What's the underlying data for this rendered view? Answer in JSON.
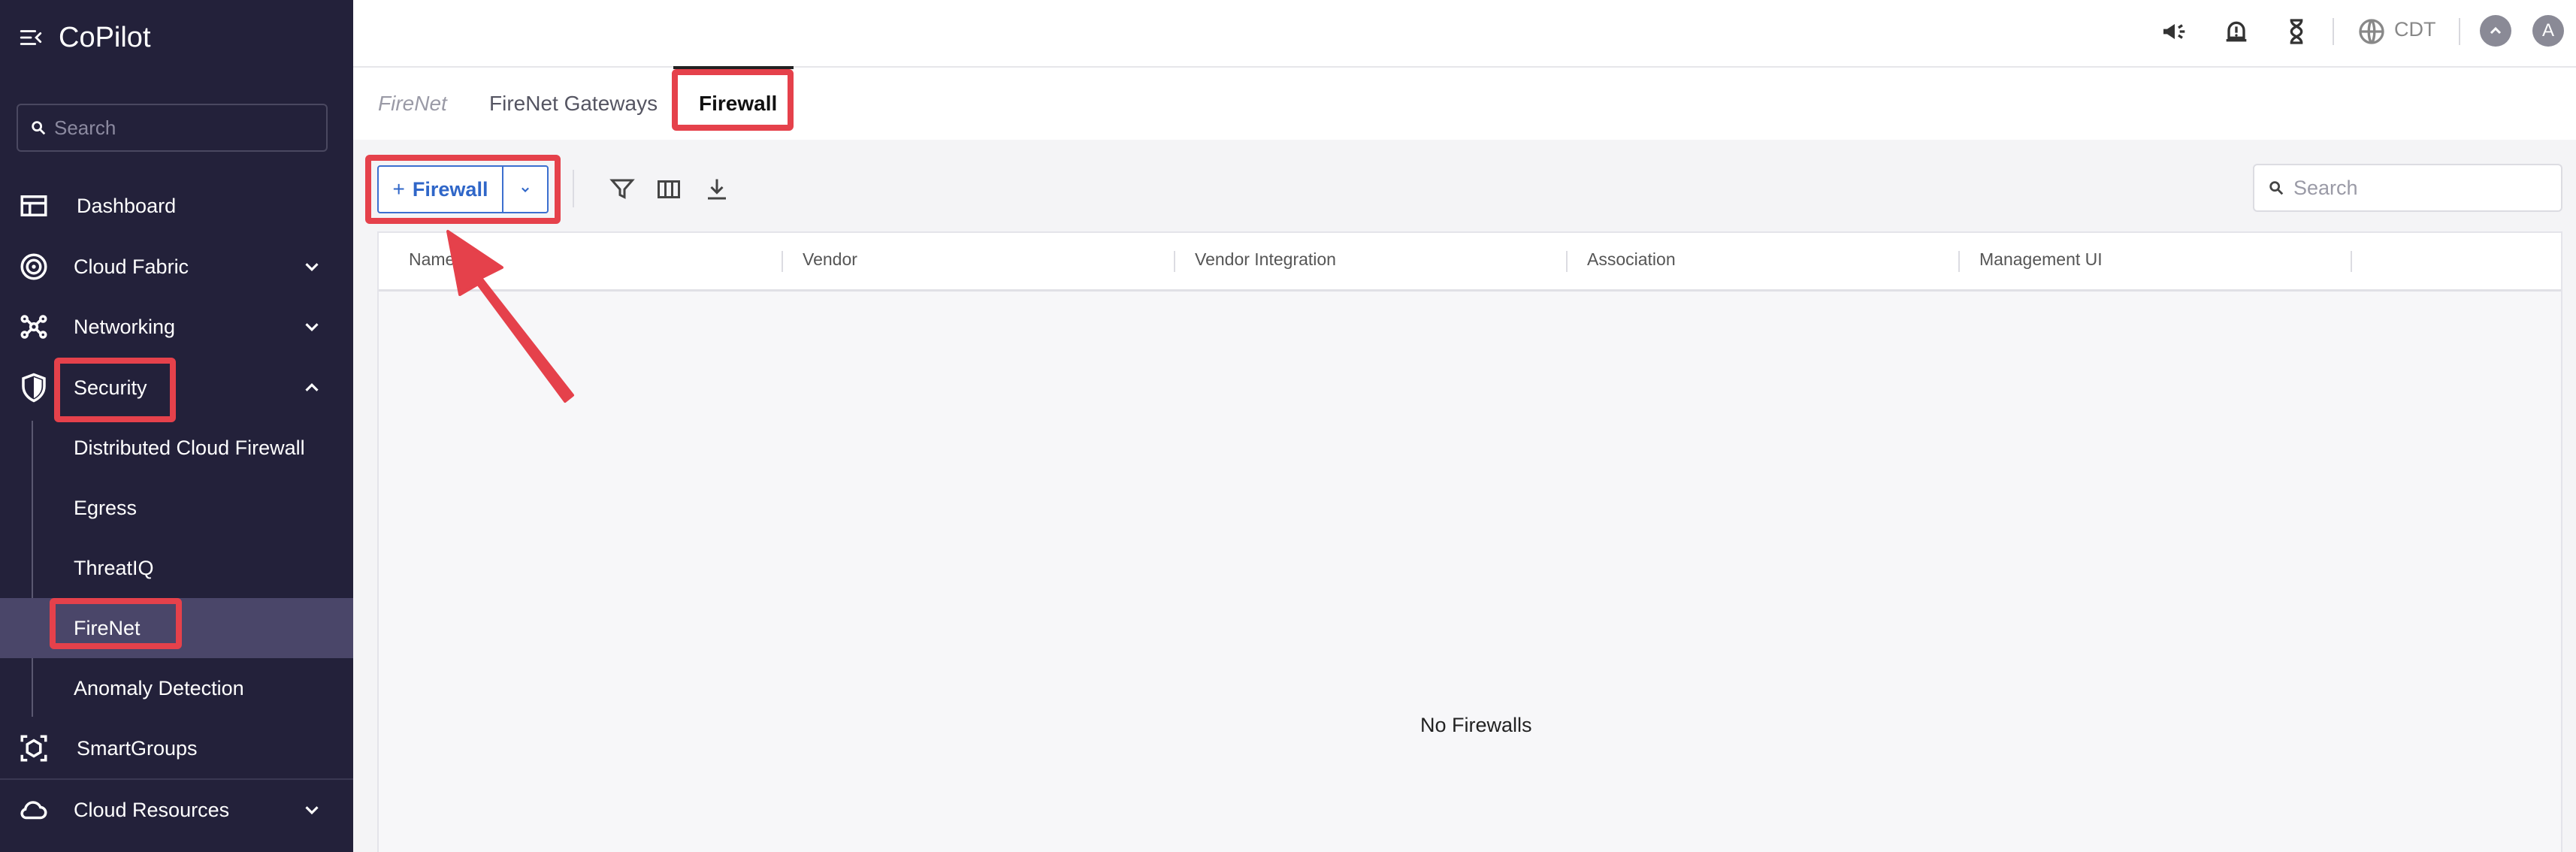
{
  "app": {
    "title": "CoPilot"
  },
  "sidebar": {
    "search_placeholder": "Search",
    "items": [
      {
        "label": "Dashboard",
        "icon": "dashboard-icon"
      },
      {
        "label": "Cloud Fabric",
        "icon": "cloud-fabric-icon"
      },
      {
        "label": "Networking",
        "icon": "networking-icon"
      },
      {
        "label": "Security",
        "icon": "shield-icon"
      },
      {
        "label": "SmartGroups",
        "icon": "smartgroups-icon"
      },
      {
        "label": "Cloud Resources",
        "icon": "cloud-icon"
      }
    ],
    "security_sub": [
      {
        "label": "Distributed Cloud Firewall"
      },
      {
        "label": "Egress"
      },
      {
        "label": "ThreatIQ"
      },
      {
        "label": "FireNet"
      },
      {
        "label": "Anomaly Detection"
      }
    ]
  },
  "topbar": {
    "icons": [
      "announcement-icon",
      "alarm-icon",
      "hourglass-icon",
      "globe-icon",
      "chevron-up-icon"
    ],
    "timezone": "CDT",
    "avatar_initial": "A"
  },
  "tabs": [
    {
      "label": "FireNet"
    },
    {
      "label": "FireNet Gateways"
    },
    {
      "label": "Firewall",
      "active": true
    }
  ],
  "toolbar": {
    "add_prefix": "+",
    "add_label": "Firewall",
    "search_placeholder": "Search"
  },
  "table": {
    "columns": [
      "Name",
      "Vendor",
      "Vendor Integration",
      "Association",
      "Management UI"
    ],
    "empty_message": "No Firewalls"
  },
  "colors": {
    "sidebar_bg": "#23213a",
    "sidebar_active": "#4a4669",
    "accent": "#2f66c8",
    "highlight": "#e5414b"
  }
}
